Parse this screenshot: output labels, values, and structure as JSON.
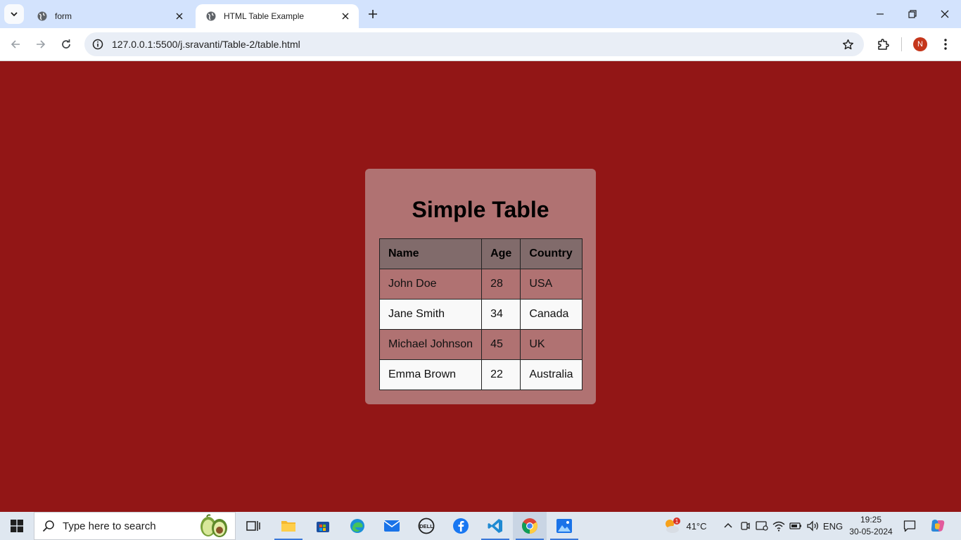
{
  "browser": {
    "tabs": [
      {
        "title": "form",
        "active": false
      },
      {
        "title": "HTML Table Example",
        "active": true
      }
    ],
    "url": "127.0.0.1:5500/j.sravanti/Table-2/table.html",
    "profile_initial": "N"
  },
  "page": {
    "background": "#921616",
    "card_color": "#b07272",
    "heading": "Simple Table",
    "table": {
      "headers": [
        "Name",
        "Age",
        "Country"
      ],
      "rows": [
        [
          "John Doe",
          "28",
          "USA"
        ],
        [
          "Jane Smith",
          "34",
          "Canada"
        ],
        [
          "Michael Johnson",
          "45",
          "UK"
        ],
        [
          "Emma Brown",
          "22",
          "Australia"
        ]
      ]
    }
  },
  "taskbar": {
    "search_placeholder": "Type here to search",
    "weather_temp": "41°C",
    "weather_badge": "1",
    "language": "ENG",
    "time": "19:25",
    "date": "30-05-2024"
  }
}
